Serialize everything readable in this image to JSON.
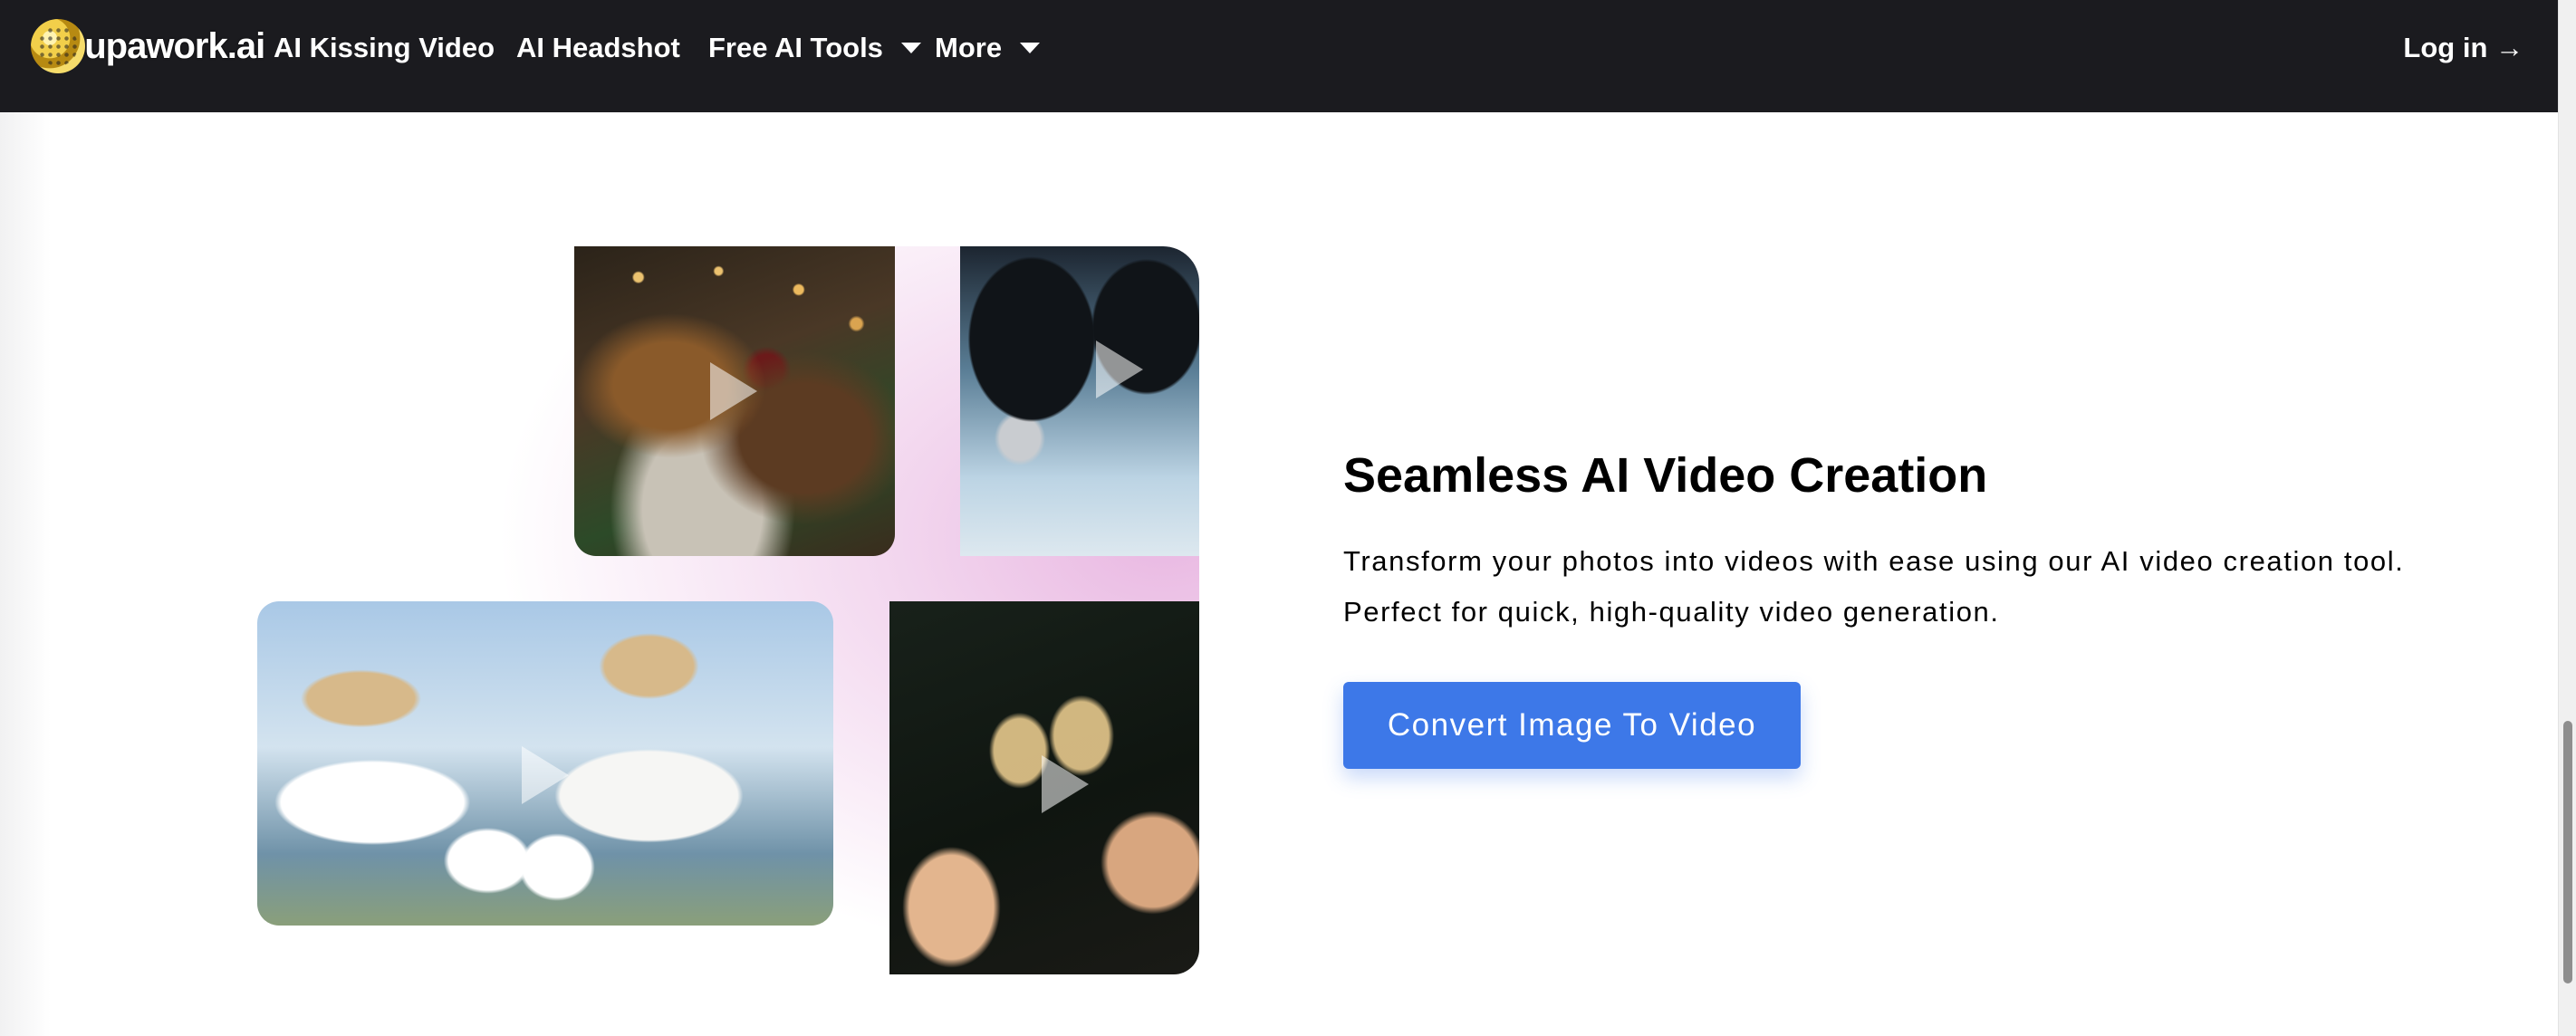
{
  "nav": {
    "logo_text": "supawork.ai",
    "items": [
      {
        "label": "AI Kissing Video"
      },
      {
        "label": "AI Headshot"
      },
      {
        "label": "Free AI Tools"
      },
      {
        "label": "More"
      }
    ],
    "login_label": "Log in →"
  },
  "feature": {
    "title": "Seamless AI Video Creation",
    "description_line1": "Transform your photos into videos with ease using our AI video creation tool.",
    "description_line2": "Perfect for quick, high-quality video generation.",
    "cta_label": "Convert Image To Video"
  },
  "colors": {
    "nav_bg": "#1b1b1f",
    "cta_bg": "#3d78e8"
  }
}
